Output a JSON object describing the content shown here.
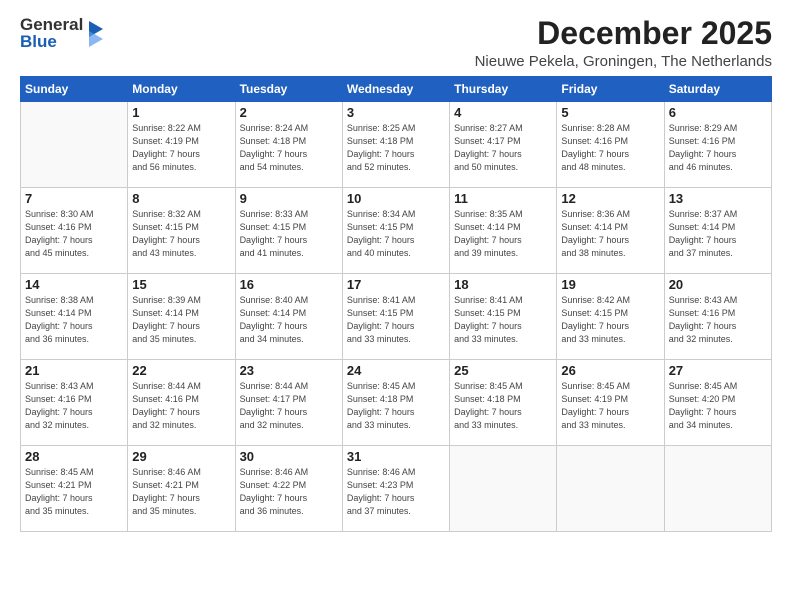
{
  "logo": {
    "general": "General",
    "blue": "Blue"
  },
  "header": {
    "month": "December 2025",
    "location": "Nieuwe Pekela, Groningen, The Netherlands"
  },
  "weekdays": [
    "Sunday",
    "Monday",
    "Tuesday",
    "Wednesday",
    "Thursday",
    "Friday",
    "Saturday"
  ],
  "weeks": [
    [
      {
        "day": "",
        "info": ""
      },
      {
        "day": "1",
        "info": "Sunrise: 8:22 AM\nSunset: 4:19 PM\nDaylight: 7 hours\nand 56 minutes."
      },
      {
        "day": "2",
        "info": "Sunrise: 8:24 AM\nSunset: 4:18 PM\nDaylight: 7 hours\nand 54 minutes."
      },
      {
        "day": "3",
        "info": "Sunrise: 8:25 AM\nSunset: 4:18 PM\nDaylight: 7 hours\nand 52 minutes."
      },
      {
        "day": "4",
        "info": "Sunrise: 8:27 AM\nSunset: 4:17 PM\nDaylight: 7 hours\nand 50 minutes."
      },
      {
        "day": "5",
        "info": "Sunrise: 8:28 AM\nSunset: 4:16 PM\nDaylight: 7 hours\nand 48 minutes."
      },
      {
        "day": "6",
        "info": "Sunrise: 8:29 AM\nSunset: 4:16 PM\nDaylight: 7 hours\nand 46 minutes."
      }
    ],
    [
      {
        "day": "7",
        "info": "Sunrise: 8:30 AM\nSunset: 4:16 PM\nDaylight: 7 hours\nand 45 minutes."
      },
      {
        "day": "8",
        "info": "Sunrise: 8:32 AM\nSunset: 4:15 PM\nDaylight: 7 hours\nand 43 minutes."
      },
      {
        "day": "9",
        "info": "Sunrise: 8:33 AM\nSunset: 4:15 PM\nDaylight: 7 hours\nand 41 minutes."
      },
      {
        "day": "10",
        "info": "Sunrise: 8:34 AM\nSunset: 4:15 PM\nDaylight: 7 hours\nand 40 minutes."
      },
      {
        "day": "11",
        "info": "Sunrise: 8:35 AM\nSunset: 4:14 PM\nDaylight: 7 hours\nand 39 minutes."
      },
      {
        "day": "12",
        "info": "Sunrise: 8:36 AM\nSunset: 4:14 PM\nDaylight: 7 hours\nand 38 minutes."
      },
      {
        "day": "13",
        "info": "Sunrise: 8:37 AM\nSunset: 4:14 PM\nDaylight: 7 hours\nand 37 minutes."
      }
    ],
    [
      {
        "day": "14",
        "info": "Sunrise: 8:38 AM\nSunset: 4:14 PM\nDaylight: 7 hours\nand 36 minutes."
      },
      {
        "day": "15",
        "info": "Sunrise: 8:39 AM\nSunset: 4:14 PM\nDaylight: 7 hours\nand 35 minutes."
      },
      {
        "day": "16",
        "info": "Sunrise: 8:40 AM\nSunset: 4:14 PM\nDaylight: 7 hours\nand 34 minutes."
      },
      {
        "day": "17",
        "info": "Sunrise: 8:41 AM\nSunset: 4:15 PM\nDaylight: 7 hours\nand 33 minutes."
      },
      {
        "day": "18",
        "info": "Sunrise: 8:41 AM\nSunset: 4:15 PM\nDaylight: 7 hours\nand 33 minutes."
      },
      {
        "day": "19",
        "info": "Sunrise: 8:42 AM\nSunset: 4:15 PM\nDaylight: 7 hours\nand 33 minutes."
      },
      {
        "day": "20",
        "info": "Sunrise: 8:43 AM\nSunset: 4:16 PM\nDaylight: 7 hours\nand 32 minutes."
      }
    ],
    [
      {
        "day": "21",
        "info": "Sunrise: 8:43 AM\nSunset: 4:16 PM\nDaylight: 7 hours\nand 32 minutes."
      },
      {
        "day": "22",
        "info": "Sunrise: 8:44 AM\nSunset: 4:16 PM\nDaylight: 7 hours\nand 32 minutes."
      },
      {
        "day": "23",
        "info": "Sunrise: 8:44 AM\nSunset: 4:17 PM\nDaylight: 7 hours\nand 32 minutes."
      },
      {
        "day": "24",
        "info": "Sunrise: 8:45 AM\nSunset: 4:18 PM\nDaylight: 7 hours\nand 33 minutes."
      },
      {
        "day": "25",
        "info": "Sunrise: 8:45 AM\nSunset: 4:18 PM\nDaylight: 7 hours\nand 33 minutes."
      },
      {
        "day": "26",
        "info": "Sunrise: 8:45 AM\nSunset: 4:19 PM\nDaylight: 7 hours\nand 33 minutes."
      },
      {
        "day": "27",
        "info": "Sunrise: 8:45 AM\nSunset: 4:20 PM\nDaylight: 7 hours\nand 34 minutes."
      }
    ],
    [
      {
        "day": "28",
        "info": "Sunrise: 8:45 AM\nSunset: 4:21 PM\nDaylight: 7 hours\nand 35 minutes."
      },
      {
        "day": "29",
        "info": "Sunrise: 8:46 AM\nSunset: 4:21 PM\nDaylight: 7 hours\nand 35 minutes."
      },
      {
        "day": "30",
        "info": "Sunrise: 8:46 AM\nSunset: 4:22 PM\nDaylight: 7 hours\nand 36 minutes."
      },
      {
        "day": "31",
        "info": "Sunrise: 8:46 AM\nSunset: 4:23 PM\nDaylight: 7 hours\nand 37 minutes."
      },
      {
        "day": "",
        "info": ""
      },
      {
        "day": "",
        "info": ""
      },
      {
        "day": "",
        "info": ""
      }
    ]
  ]
}
